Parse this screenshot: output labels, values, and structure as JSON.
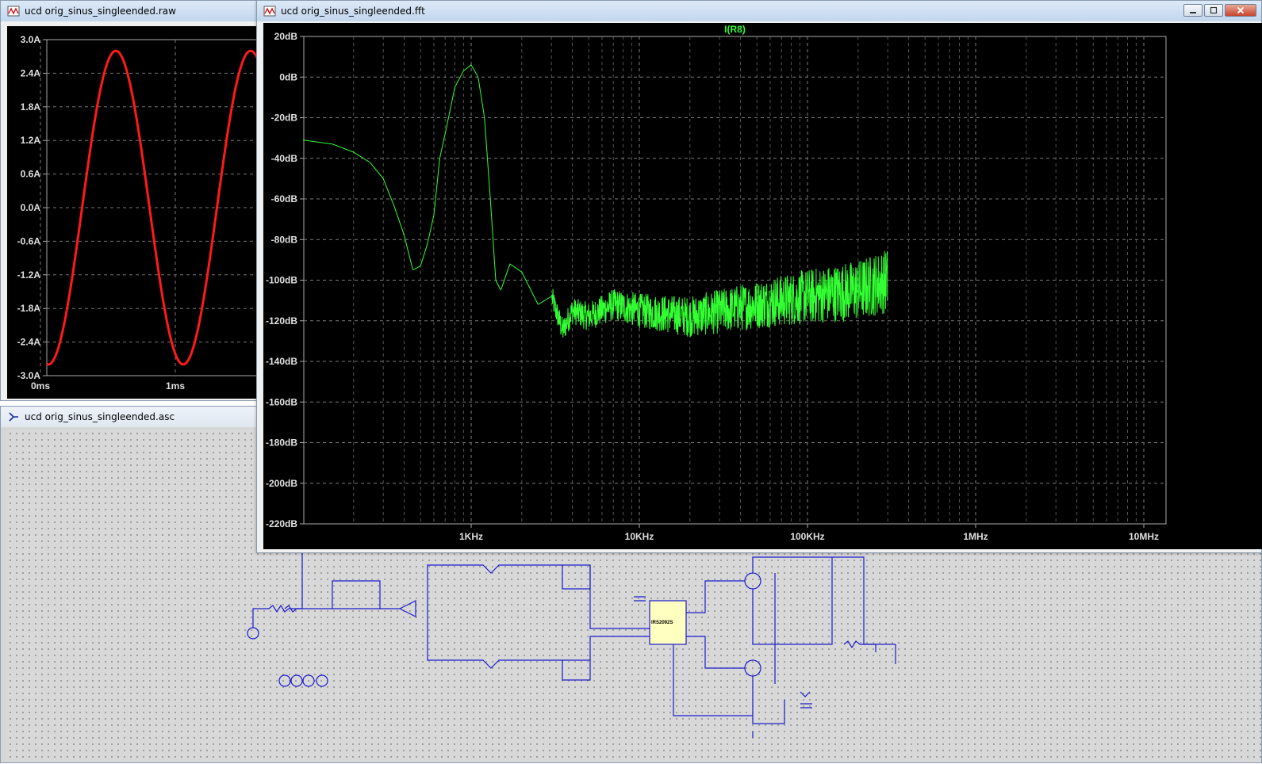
{
  "raw_window": {
    "title": "ucd orig_sinus_singleended.raw",
    "icon": "waveform-icon",
    "trace_color": "#ff1a1a",
    "y_ticks": [
      "3.0A",
      "2.4A",
      "1.8A",
      "1.2A",
      "0.6A",
      "0.0A",
      "-0.6A",
      "-1.2A",
      "-1.8A",
      "-2.4A",
      "-3.0A"
    ],
    "x_ticks": [
      "0ms",
      "1ms"
    ]
  },
  "schematic_window": {
    "title": "ucd orig_sinus_singleended.asc",
    "icon": "schematic-icon",
    "chip_label": "IRS2092S"
  },
  "fft_window": {
    "title": "ucd orig_sinus_singleended.fft",
    "icon": "waveform-icon",
    "buttons": {
      "minimize": "minimize-button",
      "maximize": "maximize-button",
      "close": "close-button"
    },
    "trace_label": "I(R8)",
    "trace_color": "#33ff33",
    "y_ticks": [
      "20dB",
      "0dB",
      "-20dB",
      "-40dB",
      "-60dB",
      "-80dB",
      "-100dB",
      "-120dB",
      "-140dB",
      "-160dB",
      "-180dB",
      "-200dB",
      "-220dB"
    ],
    "x_ticks": [
      "1KHz",
      "10KHz",
      "100KHz",
      "1MHz",
      "10MHz"
    ]
  },
  "chart_data": [
    {
      "type": "line",
      "title": "",
      "xlabel": "",
      "ylabel": "",
      "series": [
        {
          "x_ms": [
            0,
            0.25,
            0.5,
            0.75,
            1.0,
            1.25,
            1.5
          ],
          "values": [
            -2.8,
            0,
            2.8,
            0,
            -2.8,
            0,
            2.8
          ]
        }
      ],
      "ylim": [
        -3.0,
        3.0
      ],
      "grid": true
    },
    {
      "type": "line",
      "title": "I(R8)",
      "xlabel": "",
      "ylabel": "",
      "scale_x": "log",
      "xlim": [
        100,
        20000000
      ],
      "ylim": [
        -220,
        20
      ],
      "grid": true,
      "series": [
        {
          "name": "I(R8)",
          "x": [
            100,
            150,
            200,
            250,
            300,
            350,
            400,
            450,
            500,
            550,
            600,
            650,
            700,
            800,
            900,
            1000,
            1100,
            1200,
            1300,
            1400,
            1500,
            1700,
            2000,
            2500,
            3000,
            3500,
            4000,
            5000,
            7000,
            10000,
            20000,
            50000,
            100000,
            200000,
            300000
          ],
          "values": [
            -31,
            -33,
            -37,
            -42,
            -50,
            -64,
            -78,
            -95,
            -93,
            -82,
            -68,
            -40,
            -28,
            -5,
            3,
            6,
            0,
            -20,
            -60,
            -100,
            -105,
            -92,
            -96,
            -112,
            -108,
            -125,
            -115,
            -118,
            -112,
            -115,
            -118,
            -112,
            -108,
            -105,
            -100
          ]
        }
      ]
    }
  ]
}
